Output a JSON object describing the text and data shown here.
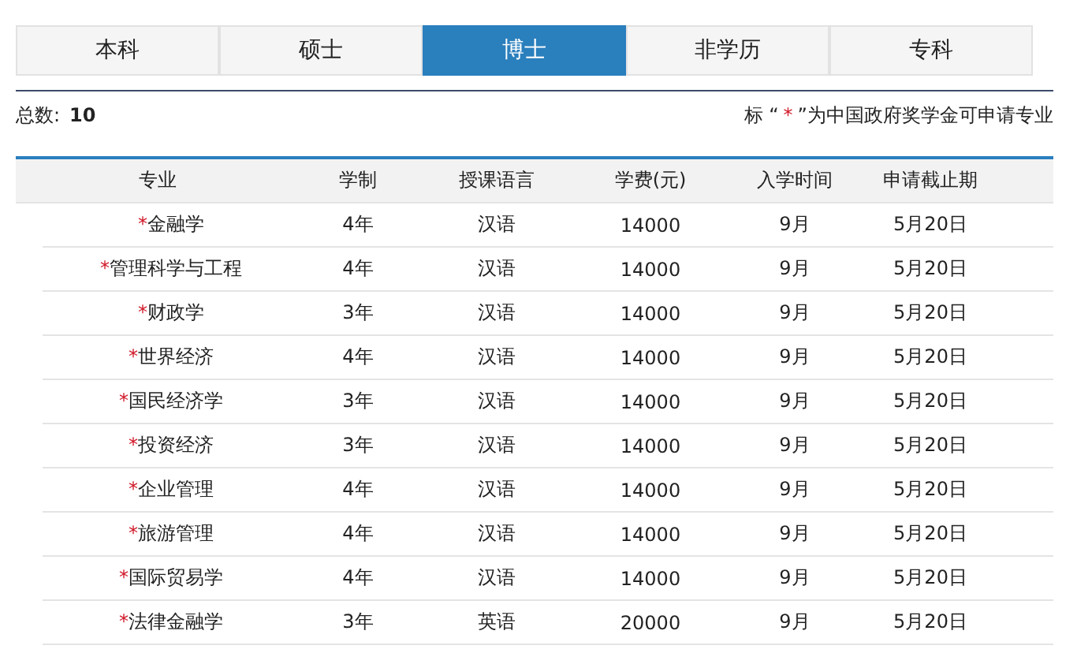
{
  "tabs": [
    {
      "label": "本科",
      "selected": false
    },
    {
      "label": "硕士",
      "selected": false
    },
    {
      "label": "博士",
      "selected": true
    },
    {
      "label": "非学历",
      "selected": false
    },
    {
      "label": "专科",
      "selected": false
    }
  ],
  "summary": {
    "label": "总数:",
    "count": "10"
  },
  "legend": {
    "prefix": "标 “",
    "mark": "*",
    "suffix": "”为中国政府奖学金可申请专业"
  },
  "table": {
    "columns": [
      "专业",
      "学制",
      "授课语言",
      "学费(元)",
      "入学时间",
      "申请截止期"
    ],
    "rows": [
      {
        "mark": "*",
        "major": "金融学",
        "duration": "4年",
        "language": "汉语",
        "fee": "14000",
        "intake": "9月",
        "deadline": "5月20日"
      },
      {
        "mark": "*",
        "major": "管理科学与工程",
        "duration": "4年",
        "language": "汉语",
        "fee": "14000",
        "intake": "9月",
        "deadline": "5月20日"
      },
      {
        "mark": "*",
        "major": "财政学",
        "duration": "3年",
        "language": "汉语",
        "fee": "14000",
        "intake": "9月",
        "deadline": "5月20日"
      },
      {
        "mark": "*",
        "major": "世界经济",
        "duration": "4年",
        "language": "汉语",
        "fee": "14000",
        "intake": "9月",
        "deadline": "5月20日"
      },
      {
        "mark": "*",
        "major": "国民经济学",
        "duration": "3年",
        "language": "汉语",
        "fee": "14000",
        "intake": "9月",
        "deadline": "5月20日"
      },
      {
        "mark": "*",
        "major": "投资经济",
        "duration": "3年",
        "language": "汉语",
        "fee": "14000",
        "intake": "9月",
        "deadline": "5月20日"
      },
      {
        "mark": "*",
        "major": "企业管理",
        "duration": "4年",
        "language": "汉语",
        "fee": "14000",
        "intake": "9月",
        "deadline": "5月20日"
      },
      {
        "mark": "*",
        "major": "旅游管理",
        "duration": "4年",
        "language": "汉语",
        "fee": "14000",
        "intake": "9月",
        "deadline": "5月20日"
      },
      {
        "mark": "*",
        "major": "国际贸易学",
        "duration": "4年",
        "language": "汉语",
        "fee": "14000",
        "intake": "9月",
        "deadline": "5月20日"
      },
      {
        "mark": "*",
        "major": "法律金融学",
        "duration": "3年",
        "language": "英语",
        "fee": "20000",
        "intake": "9月",
        "deadline": "5月20日"
      }
    ]
  }
}
